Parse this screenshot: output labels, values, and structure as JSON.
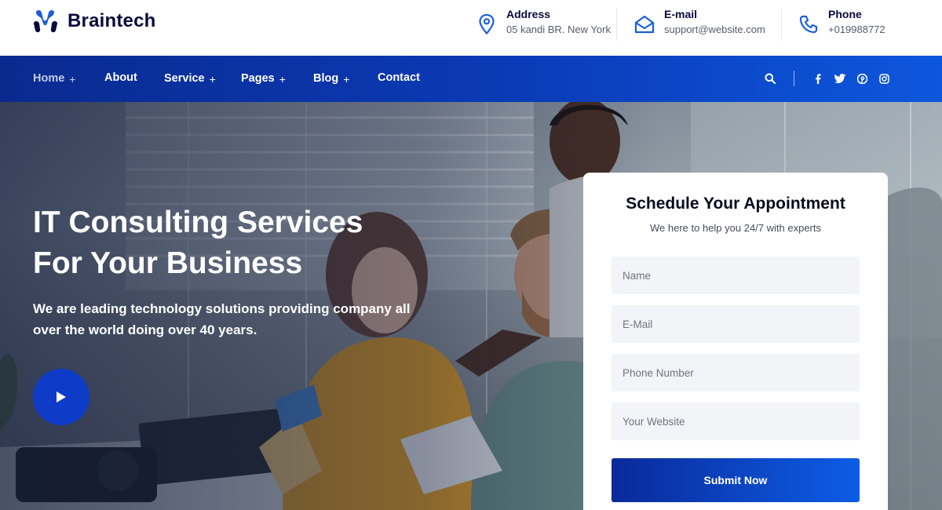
{
  "brand": {
    "name": "Braintech"
  },
  "contacts": [
    {
      "title": "Address",
      "value": "05 kandi BR. New York",
      "icon": "map-pin-icon"
    },
    {
      "title": "E-mail",
      "value": "support@website.com",
      "icon": "envelope-open-icon"
    },
    {
      "title": "Phone",
      "value": "+019988772",
      "icon": "phone-icon"
    }
  ],
  "nav": {
    "items": [
      {
        "label": "Home",
        "plus": "+"
      },
      {
        "label": "About",
        "plus": ""
      },
      {
        "label": "Service",
        "plus": "+"
      },
      {
        "label": "Pages",
        "plus": "+"
      },
      {
        "label": "Blog",
        "plus": "+"
      },
      {
        "label": "Contact",
        "plus": ""
      }
    ],
    "social": [
      "facebook-icon",
      "twitter-icon",
      "pinterest-icon",
      "instagram-icon"
    ]
  },
  "hero": {
    "title_line1": "IT Consulting Services",
    "title_line2": "For Your Business",
    "subtitle": "We are leading technology solutions providing company all over the world doing over 40 years."
  },
  "appointment": {
    "title": "Schedule Your Appointment",
    "subtitle": "We here to help you 24/7 with experts",
    "name_placeholder": "Name",
    "email_placeholder": "E-Mail",
    "phone_placeholder": "Phone Number",
    "website_placeholder": "Your Website",
    "submit_label": "Submit Now"
  },
  "colors": {
    "brand_navy": "#0a0a3c",
    "accent_blue": "#0d57dd",
    "nav_dark": "#0a2a8f"
  }
}
